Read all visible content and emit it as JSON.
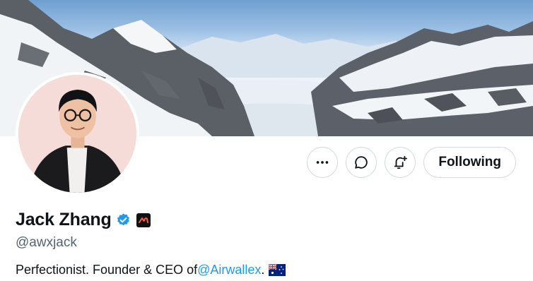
{
  "profile": {
    "display_name": "Jack Zhang",
    "handle": "@awxjack",
    "verified": true,
    "affiliation_icon": "airwallex-logo-icon",
    "bio": {
      "prefix": "Perfectionist. Founder & CEO of ",
      "mention": "@Airwallex",
      "suffix": ".",
      "flag_icon": "australia-flag-icon"
    }
  },
  "actions": {
    "more_icon": "more-dots-icon",
    "message_icon": "message-bubble-icon",
    "notify_icon": "bell-plus-icon",
    "follow_label": "Following"
  },
  "colors": {
    "accent": "#1d9bf0",
    "text_primary": "#0f1419",
    "text_secondary": "#536471",
    "border": "#cfd9de"
  }
}
